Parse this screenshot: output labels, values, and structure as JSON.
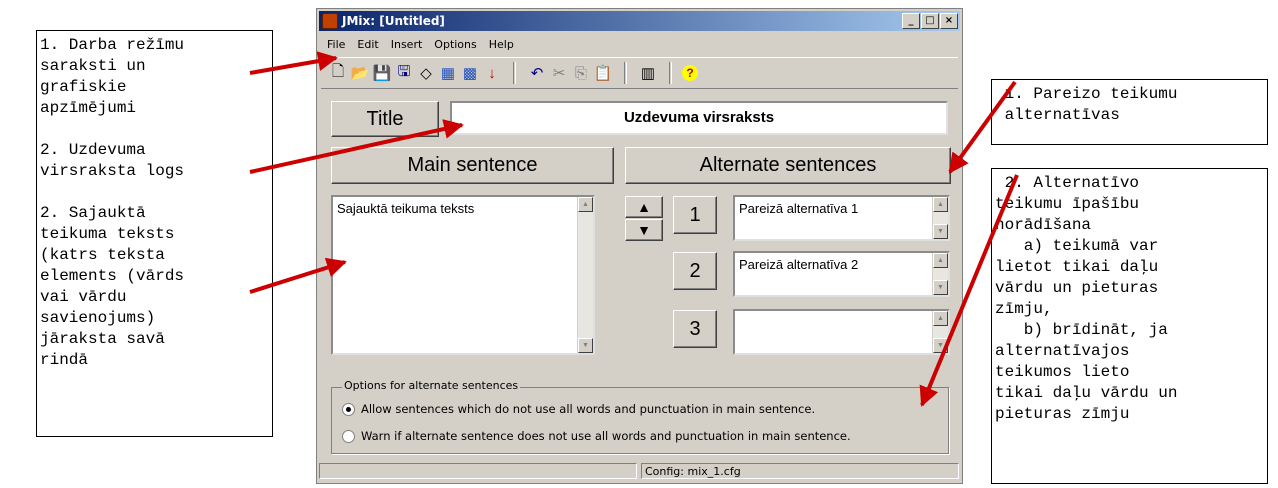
{
  "window": {
    "title": "JMix: [Untitled]",
    "controls": [
      "_",
      "□",
      "×"
    ]
  },
  "menu": [
    "File",
    "Edit",
    "Insert",
    "Options",
    "Help"
  ],
  "toolbar_icons": [
    "new-icon",
    "open-icon",
    "save-icon",
    "save-as-icon",
    "clear-icon",
    "export-web-icon",
    "export-web-alt-icon",
    "add-icon",
    "undo-icon",
    "cut-icon",
    "copy-icon",
    "paste-icon",
    "config-icon",
    "help-icon"
  ],
  "title_row": {
    "label": "Title",
    "value": "Uzdevuma virsraksts"
  },
  "headers": {
    "main": "Main sentence",
    "alternate": "Alternate sentences"
  },
  "main_sentence": {
    "text": "Sajauktā teikuma teksts"
  },
  "alternates": [
    {
      "number": "1",
      "text": "Pareizā alternatīva 1"
    },
    {
      "number": "2",
      "text": "Pareizā alternatīva 2"
    },
    {
      "number": "3",
      "text": ""
    }
  ],
  "options": {
    "title": "Options for alternate sentences",
    "allow": "Allow sentences which do not use all words and punctuation in main sentence.",
    "warn": "Warn if alternate sentence does not use all words and punctuation in main sentence.",
    "selected": "allow"
  },
  "status": {
    "left": "",
    "config": "Config: mix_1.cfg"
  },
  "callouts": {
    "left1": "1. Darba režīmu\nsaraksti un\ngrafiskie\napzīmējumi\n\n2. Uzdevuma\nvirsraksta logs\n\n2. Sajauktā\nteikuma teksts\n(katrs teksta\nelements (vārds\nvai vārdu\nsavienojums)\njāraksta savā\nrindā",
    "right1": " 1. Pareizo teikumu\n alternatīvas",
    "right2": " 2. Alternatīvo\nteikumu īpašību\nnorādīšana\n   a) teikumā var\nlietot tikai daļu\nvārdu un pieturas\nzīmju,\n   b) brīdināt, ja\nalternatīvajos\nteikumos lieto\ntikai daļu vārdu un\npieturas zīmju"
  },
  "colors": {
    "arrow": "#cc0000",
    "titlebar": "#0a246a",
    "window": "#d4d0c8"
  }
}
